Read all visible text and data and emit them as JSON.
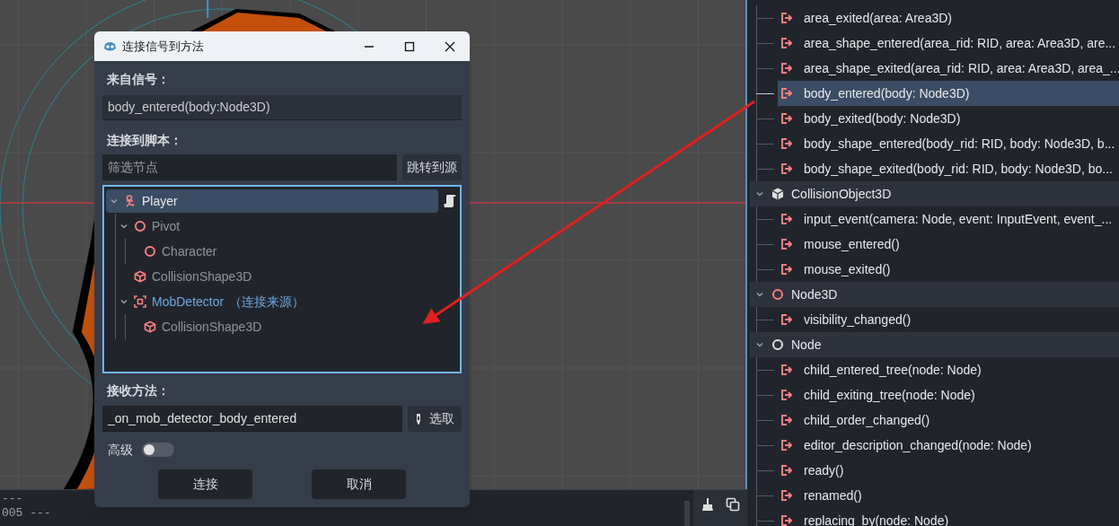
{
  "dialog": {
    "title": "连接信号到方法",
    "from_signal_label": "来自信号：",
    "signal": "body_entered(body:Node3D)",
    "connect_to_label": "连接到脚本：",
    "filter": {
      "placeholder": "筛选节点"
    },
    "goto_source_button": "跳转到源",
    "nodes": [
      {
        "name": "Player",
        "kind": "player",
        "selected": true,
        "disabled": false,
        "source": false,
        "script": true,
        "expanded": true,
        "children": [
          {
            "name": "Pivot",
            "kind": "node3d",
            "selected": false,
            "disabled": true,
            "source": false,
            "script": false,
            "expanded": true,
            "children": [
              {
                "name": "Character",
                "kind": "node3d",
                "selected": false,
                "disabled": true,
                "source": false,
                "script": false
              }
            ]
          },
          {
            "name": "CollisionShape3D",
            "kind": "shape",
            "selected": false,
            "disabled": true,
            "source": false,
            "script": false
          },
          {
            "name": "MobDetector",
            "note": "（连接来源）",
            "kind": "area",
            "selected": false,
            "disabled": false,
            "source": true,
            "script": false,
            "expanded": true,
            "children": [
              {
                "name": "CollisionShape3D",
                "kind": "shape",
                "selected": false,
                "disabled": true,
                "source": false,
                "script": false
              }
            ]
          }
        ]
      }
    ],
    "receiver_label": "接收方法：",
    "method": "_on_mob_detector_body_entered",
    "pick_button": "选取",
    "advanced": {
      "label": "高级",
      "on": false
    },
    "buttons": [
      "连接",
      "取消"
    ]
  },
  "output": {
    "lines": [
      "---",
      "005 ---"
    ]
  },
  "signals": [
    {
      "kind": "signal",
      "text": "area_exited(area: Area3D)",
      "selected": false
    },
    {
      "kind": "signal",
      "text": "area_shape_entered(area_rid: RID, area: Area3D, are...",
      "selected": false
    },
    {
      "kind": "signal",
      "text": "area_shape_exited(area_rid: RID, area: Area3D, area_...",
      "selected": false
    },
    {
      "kind": "signal",
      "text": "body_entered(body: Node3D)",
      "selected": true
    },
    {
      "kind": "signal",
      "text": "body_exited(body: Node3D)",
      "selected": false
    },
    {
      "kind": "signal",
      "text": "body_shape_entered(body_rid: RID, body: Node3D, b...",
      "selected": false
    },
    {
      "kind": "signal",
      "text": "body_shape_exited(body_rid: RID, body: Node3D, bo...",
      "selected": false
    },
    {
      "kind": "cube-class",
      "text": "CollisionObject3D",
      "color": "#e0e0e0",
      "selected": false
    },
    {
      "kind": "signal",
      "text": "input_event(camera: Node, event: InputEvent, event_...",
      "selected": false
    },
    {
      "kind": "signal",
      "text": "mouse_entered()",
      "selected": false
    },
    {
      "kind": "signal",
      "text": "mouse_exited()",
      "selected": false
    },
    {
      "kind": "circle-class",
      "text": "Node3D",
      "color": "#fc7f7f",
      "selected": false
    },
    {
      "kind": "signal",
      "text": "visibility_changed()",
      "selected": false
    },
    {
      "kind": "circle-class",
      "text": "Node",
      "color": "#e0e0e0",
      "selected": false
    },
    {
      "kind": "signal",
      "text": "child_entered_tree(node: Node)",
      "selected": false
    },
    {
      "kind": "signal",
      "text": "child_exiting_tree(node: Node)",
      "selected": false
    },
    {
      "kind": "signal",
      "text": "child_order_changed()",
      "selected": false
    },
    {
      "kind": "signal",
      "text": "editor_description_changed(node: Node)",
      "selected": false
    },
    {
      "kind": "signal",
      "text": "ready()",
      "selected": false
    },
    {
      "kind": "signal",
      "text": "renamed()",
      "selected": false
    },
    {
      "kind": "signal",
      "text": "replacing_by(node: Node)",
      "selected": false
    }
  ]
}
